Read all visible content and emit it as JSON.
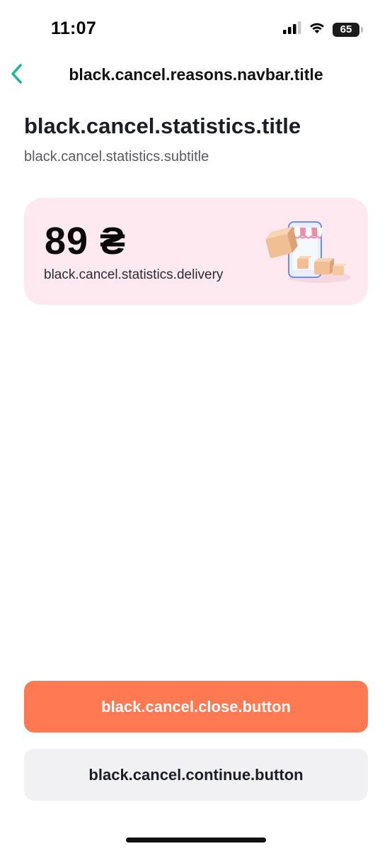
{
  "status_bar": {
    "time": "11:07",
    "battery_level": "65",
    "icons": [
      "cellular-signal-icon",
      "wifi-icon",
      "battery-icon"
    ]
  },
  "navbar": {
    "back_icon": "chevron-left-icon",
    "title": "black.cancel.reasons.navbar.title"
  },
  "page": {
    "title": "black.cancel.statistics.title",
    "subtitle": "black.cancel.statistics.subtitle"
  },
  "stat_card": {
    "value": "89 ₴",
    "label": "black.cancel.statistics.delivery",
    "illustration": "delivery-boxes-phone-illustration"
  },
  "buttons": {
    "close_label": "black.cancel.close.button",
    "continue_label": "black.cancel.continue.button"
  },
  "colors": {
    "accent_teal": "#1fb89b",
    "primary_button": "#ff7a52",
    "secondary_button": "#f1f1f4",
    "card_background": "#fde9ef",
    "text_primary": "#1d1d27",
    "text_secondary": "#5a5a62"
  }
}
